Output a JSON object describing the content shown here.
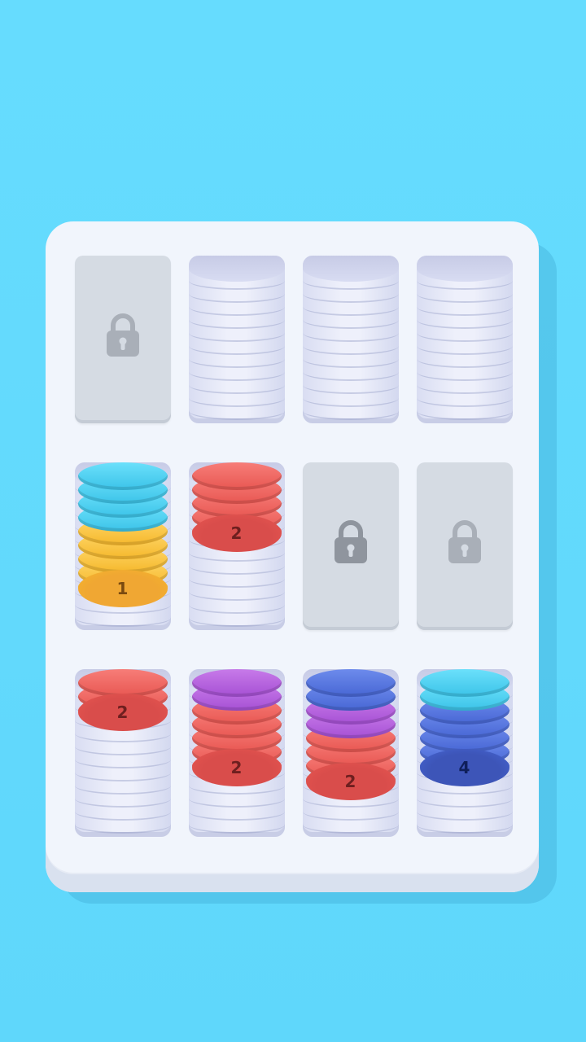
{
  "board": {
    "slots": [
      {
        "id": "r1c1",
        "state": "locked"
      },
      {
        "id": "r1c2",
        "state": "empty"
      },
      {
        "id": "r1c3",
        "state": "empty"
      },
      {
        "id": "r1c4",
        "state": "empty"
      },
      {
        "id": "r2c1",
        "state": "filled",
        "top_count": "1",
        "layers": [
          {
            "color": "cyan",
            "count": 4
          },
          {
            "color": "yellow",
            "count": 5
          }
        ]
      },
      {
        "id": "r2c2",
        "state": "filled",
        "top_count": "2",
        "layers": [
          {
            "color": "red",
            "count": 5
          }
        ]
      },
      {
        "id": "r2c3",
        "state": "locked"
      },
      {
        "id": "r2c4",
        "state": "locked"
      },
      {
        "id": "r3c1",
        "state": "filled",
        "top_count": "2",
        "layers": [
          {
            "color": "red",
            "count": 3
          }
        ]
      },
      {
        "id": "r3c2",
        "state": "filled",
        "top_count": "2",
        "layers": [
          {
            "color": "purple",
            "count": 2
          },
          {
            "color": "red",
            "count": 5
          }
        ]
      },
      {
        "id": "r3c3",
        "state": "filled",
        "top_count": "2",
        "layers": [
          {
            "color": "blue",
            "count": 2
          },
          {
            "color": "purple",
            "count": 2
          },
          {
            "color": "red",
            "count": 4
          }
        ]
      },
      {
        "id": "r3c4",
        "state": "filled",
        "top_count": "4",
        "layers": [
          {
            "color": "cyan",
            "count": 2
          },
          {
            "color": "blue",
            "count": 5
          }
        ]
      }
    ],
    "labels": {
      "r2c1": "1",
      "r2c2": "2",
      "r3c1": "2",
      "r3c2": "2",
      "r3c3": "2",
      "r3c4": "4"
    }
  },
  "colors": {
    "background": "#62dafd",
    "board": "#f1f5fc",
    "locked_slot": "#d5dbe3",
    "lock_icon": "#a9afb8",
    "cyan": "#45d3f5",
    "yellow": "#ffc83a",
    "red": "#f0625f",
    "purple": "#b55be0",
    "blue": "#4f6fe0"
  },
  "icons": {
    "locked_slot": "lock-icon"
  }
}
